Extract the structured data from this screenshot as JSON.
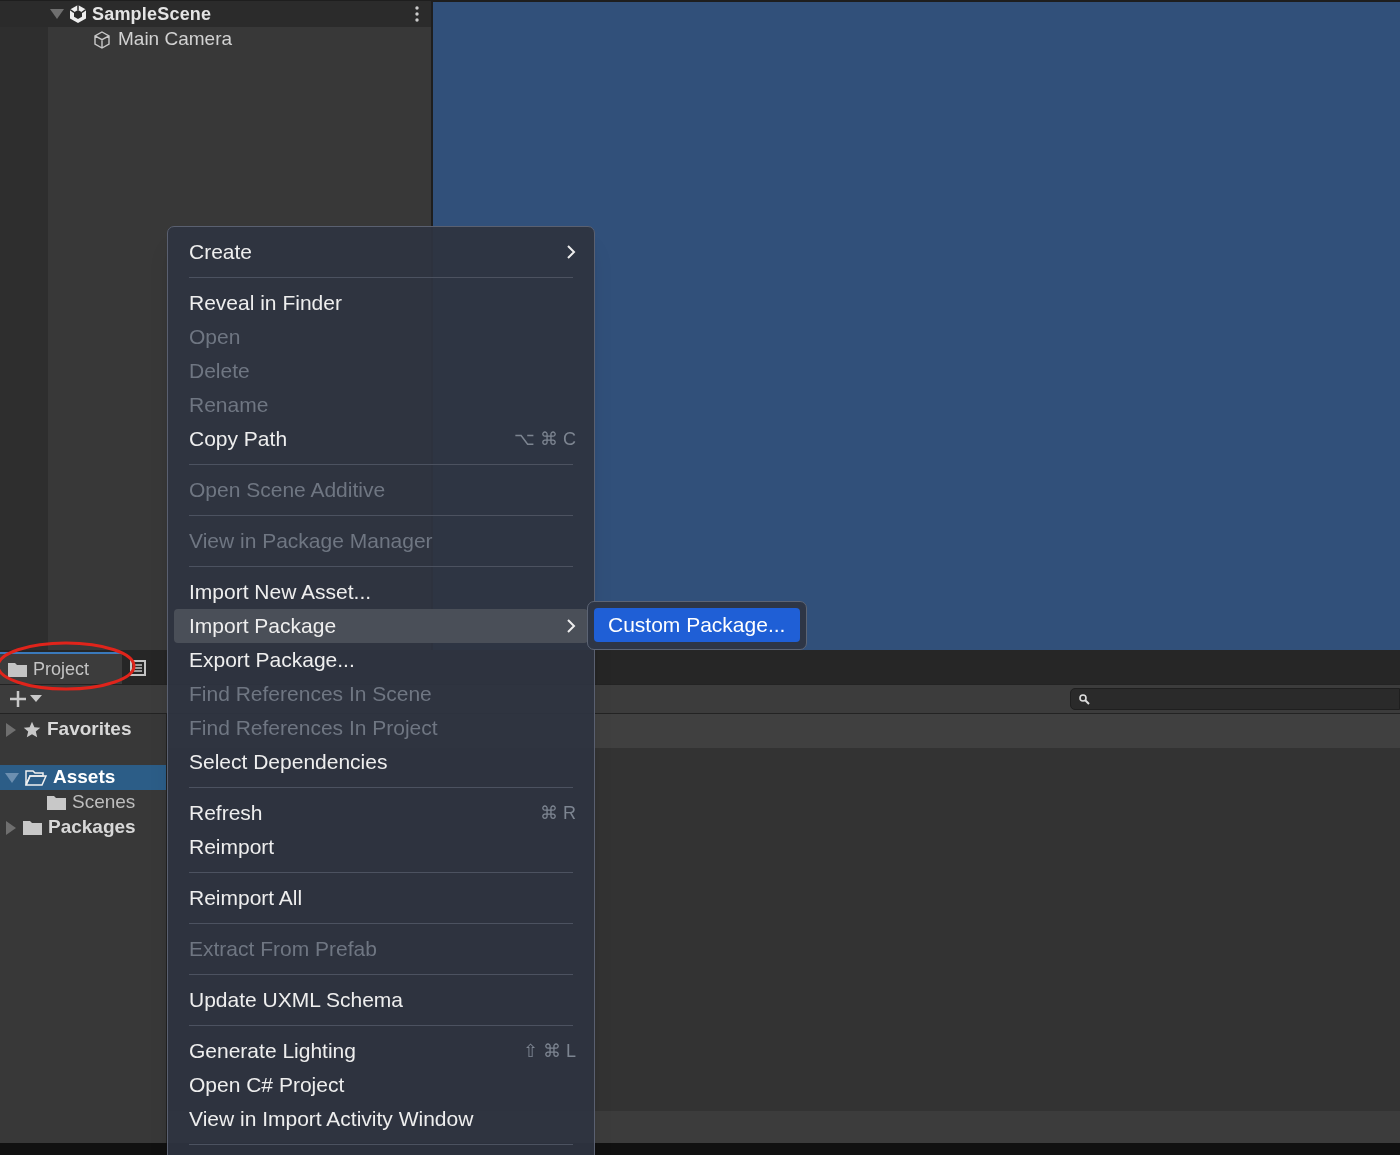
{
  "hierarchy": {
    "scene": {
      "name": "SampleScene",
      "expanded": true
    },
    "items": [
      {
        "name": "Main Camera"
      }
    ]
  },
  "project": {
    "tabs": [
      {
        "label": "Project",
        "selected": true
      },
      {
        "selected": false
      }
    ],
    "tree": [
      {
        "name": "Favorites",
        "expanded": false,
        "selected": false
      },
      {
        "name": "Assets",
        "expanded": true,
        "selected": true,
        "children": [
          {
            "name": "Scenes",
            "selected": false
          }
        ]
      },
      {
        "name": "Packages",
        "expanded": false,
        "selected": false
      }
    ]
  },
  "context_menu": {
    "items": [
      {
        "kind": "item",
        "label": "Create",
        "disabled": false,
        "submenu": true,
        "selected": false
      },
      {
        "kind": "separator"
      },
      {
        "kind": "item",
        "label": "Reveal in Finder",
        "disabled": false,
        "selected": false
      },
      {
        "kind": "item",
        "label": "Open",
        "disabled": true,
        "selected": false
      },
      {
        "kind": "item",
        "label": "Delete",
        "disabled": true,
        "selected": false
      },
      {
        "kind": "item",
        "label": "Rename",
        "disabled": true,
        "selected": false
      },
      {
        "kind": "item",
        "label": "Copy Path",
        "disabled": false,
        "shortcut": "⌥ ⌘ C",
        "selected": false
      },
      {
        "kind": "separator"
      },
      {
        "kind": "item",
        "label": "Open Scene Additive",
        "disabled": true,
        "selected": false
      },
      {
        "kind": "separator"
      },
      {
        "kind": "item",
        "label": "View in Package Manager",
        "disabled": true,
        "selected": false
      },
      {
        "kind": "separator"
      },
      {
        "kind": "item",
        "label": "Import New Asset...",
        "disabled": false,
        "selected": false
      },
      {
        "kind": "item",
        "label": "Import Package",
        "disabled": false,
        "submenu": true,
        "selected": true
      },
      {
        "kind": "item",
        "label": "Export Package...",
        "disabled": false,
        "selected": false
      },
      {
        "kind": "item",
        "label": "Find References In Scene",
        "disabled": true,
        "selected": false
      },
      {
        "kind": "item",
        "label": "Find References In Project",
        "disabled": true,
        "selected": false
      },
      {
        "kind": "item",
        "label": "Select Dependencies",
        "disabled": false,
        "selected": false
      },
      {
        "kind": "separator"
      },
      {
        "kind": "item",
        "label": "Refresh",
        "disabled": false,
        "shortcut": "⌘ R",
        "selected": false
      },
      {
        "kind": "item",
        "label": "Reimport",
        "disabled": false,
        "selected": false
      },
      {
        "kind": "separator"
      },
      {
        "kind": "item",
        "label": "Reimport All",
        "disabled": false,
        "selected": false
      },
      {
        "kind": "separator"
      },
      {
        "kind": "item",
        "label": "Extract From Prefab",
        "disabled": true,
        "selected": false
      },
      {
        "kind": "separator"
      },
      {
        "kind": "item",
        "label": "Update UXML Schema",
        "disabled": false,
        "selected": false
      },
      {
        "kind": "separator"
      },
      {
        "kind": "item",
        "label": "Generate Lighting",
        "disabled": false,
        "shortcut": "⇧ ⌘ L",
        "selected": false
      },
      {
        "kind": "item",
        "label": "Open C# Project",
        "disabled": false,
        "selected": false
      },
      {
        "kind": "item",
        "label": "View in Import Activity Window",
        "disabled": false,
        "selected": false
      },
      {
        "kind": "separator"
      }
    ]
  },
  "submenu": {
    "items": [
      {
        "label": "Custom Package...",
        "selected": true
      }
    ]
  }
}
